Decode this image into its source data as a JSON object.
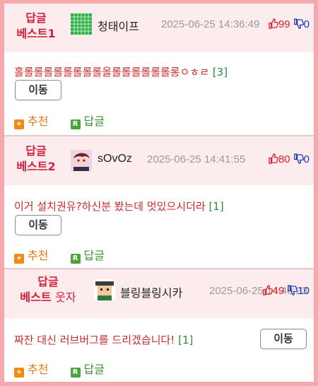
{
  "comments": [
    {
      "badge_line1": "답글",
      "badge_line2": "베스트1",
      "nickname": "청태이프",
      "avatar_icon": "green-grid-icon",
      "date": "2025-06-25 14:36:49",
      "upvotes": "99",
      "downvotes": "0",
      "text": "홀롤롤롤롤롤롤롤롤올롤롤롤롤롤롤롱ㅇㅎㄹ",
      "reply_count": "[3]",
      "move_label": "이동",
      "recommend_label": "추천",
      "reply_label": "답글"
    },
    {
      "badge_line1": "답글",
      "badge_line2": "베스트2",
      "nickname": "sOvOz",
      "avatar_icon": "anime-avatar-icon",
      "date": "2025-06-25 14:41:55",
      "upvotes": "80",
      "downvotes": "0",
      "text": "이거 설치권유?하신분 봤는데 멋있으시더라",
      "reply_count": "[1]",
      "move_label": "이동",
      "recommend_label": "추천",
      "reply_label": "답글"
    },
    {
      "badge_line1": "답글",
      "badge_line2": "베스트",
      "badge_suffix": "웃자",
      "nickname": "블링블링시카",
      "avatar_icon": "pixel-character-icon",
      "date": "2025-06-25 14:40:23",
      "upvotes": "49",
      "downvotes": "10",
      "text": "짜잔 대신 러브버그를 드리겠습니다!",
      "reply_count": "[1]",
      "move_label": "이동",
      "recommend_label": "추천",
      "reply_label": "답글"
    }
  ],
  "colors": {
    "frame": "#f6a9ad",
    "header_bg": "#fcecee",
    "badge": "#d2213c",
    "up": "#e3202e",
    "down": "#1a3bb8"
  }
}
